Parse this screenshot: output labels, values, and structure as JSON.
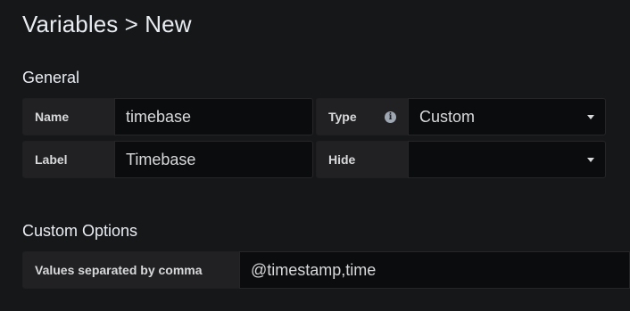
{
  "page": {
    "title": "Variables > New"
  },
  "general": {
    "section_title": "General",
    "name": {
      "label": "Name",
      "value": "timebase"
    },
    "type": {
      "label": "Type",
      "value": "Custom",
      "info_icon": "info-circle-icon"
    },
    "label": {
      "label": "Label",
      "value": "Timebase"
    },
    "hide": {
      "label": "Hide",
      "value": ""
    }
  },
  "custom_options": {
    "section_title": "Custom Options",
    "values": {
      "label": "Values separated by comma",
      "value": "@timestamp,time"
    }
  },
  "colors": {
    "background": "#161719",
    "label_bg": "#212124",
    "input_bg": "#0b0c0e",
    "text": "#d8d9da"
  }
}
